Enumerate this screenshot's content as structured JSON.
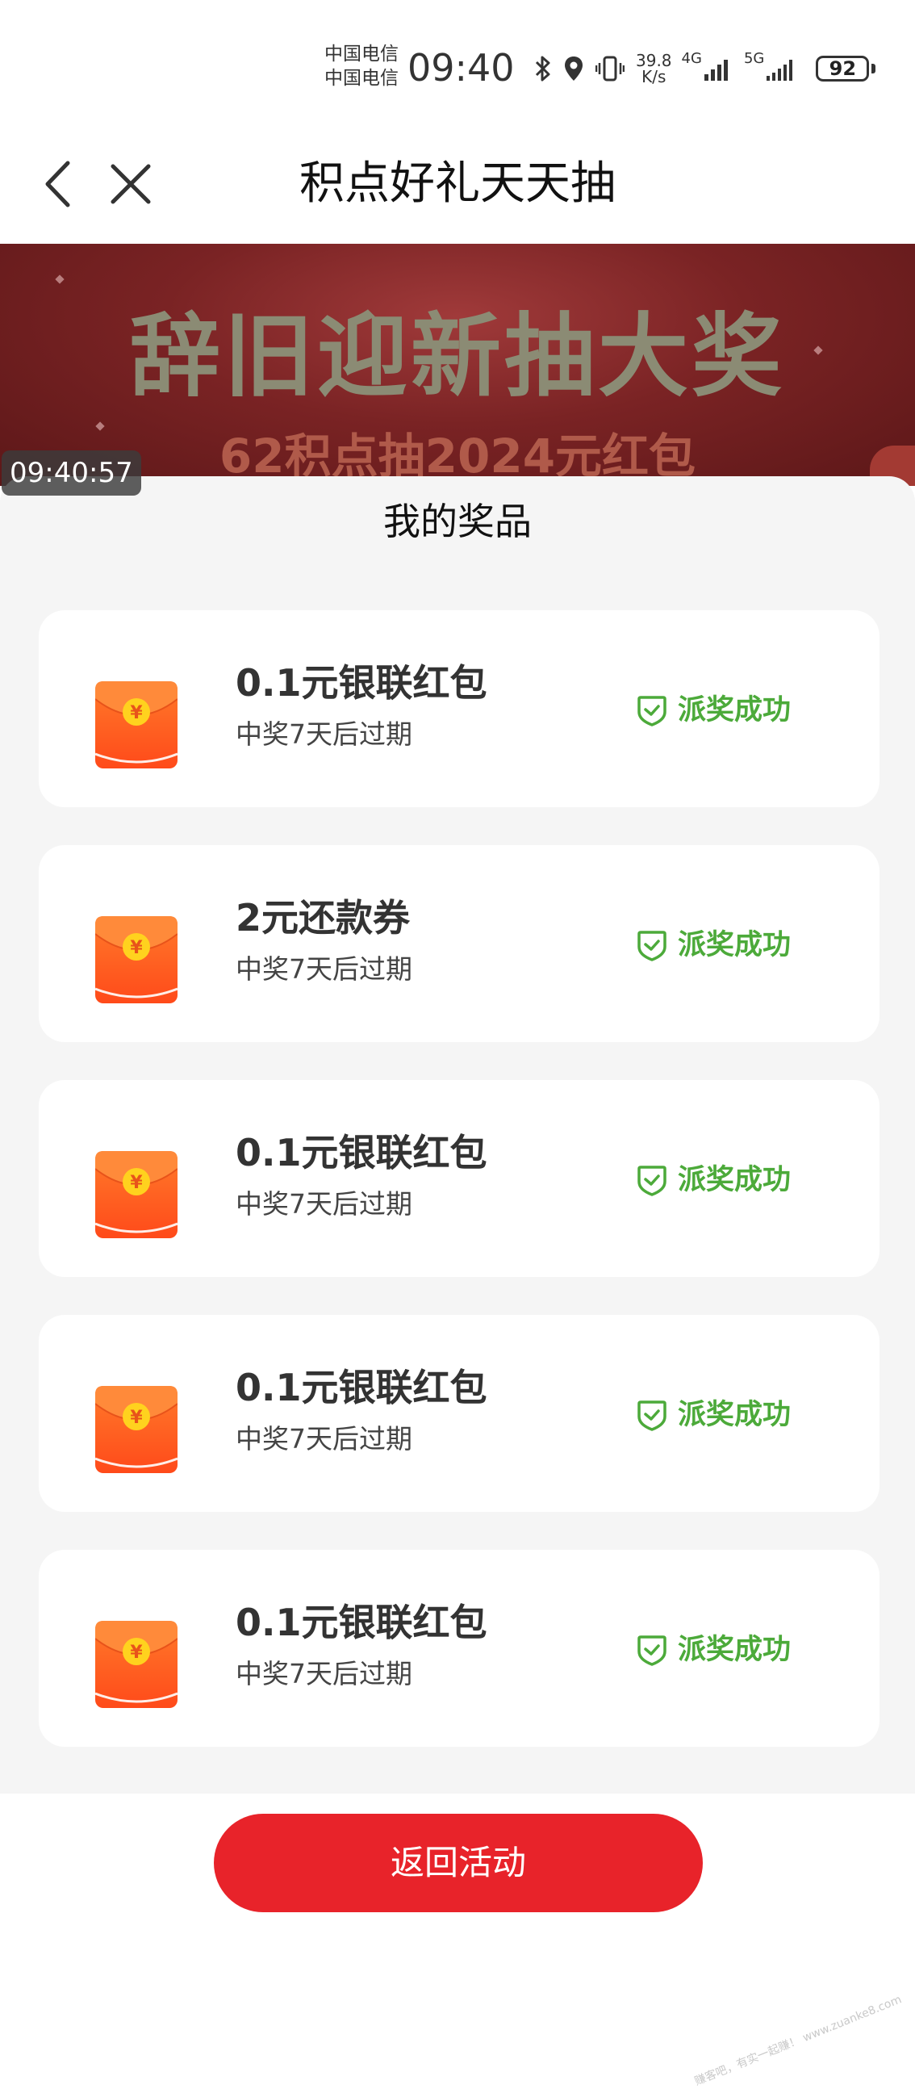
{
  "status_bar": {
    "carrier_1": "中国电信",
    "carrier_2": "中国电信",
    "time": "09:40",
    "net_speed_value": "39.8",
    "net_speed_unit": "K/s",
    "network_1": "4G",
    "network_2": "5G",
    "battery": "92"
  },
  "header": {
    "title": "积点好礼天天抽"
  },
  "banner": {
    "title": "辞旧迎新抽大奖",
    "subtitle": "62积点抽2024元红包"
  },
  "overlay": {
    "timestamp": "09:40:57"
  },
  "sheet": {
    "title": "我的奖品"
  },
  "prizes": [
    {
      "name": "0.1元银联红包",
      "expire": "中奖7天后过期",
      "status": "派奖成功"
    },
    {
      "name": "2元还款券",
      "expire": "中奖7天后过期",
      "status": "派奖成功"
    },
    {
      "name": "0.1元银联红包",
      "expire": "中奖7天后过期",
      "status": "派奖成功"
    },
    {
      "name": "0.1元银联红包",
      "expire": "中奖7天后过期",
      "status": "派奖成功"
    },
    {
      "name": "0.1元银联红包",
      "expire": "中奖7天后过期",
      "status": "派奖成功"
    }
  ],
  "footer": {
    "return_label": "返回活动",
    "watermark": "赚客吧，有实一起赚！ www.zuanke8.com"
  },
  "colors": {
    "primary_red": "#e8232a",
    "success_green": "#4caa3a",
    "envelope_orange": "#ff5a1f",
    "coin_yellow": "#ffd21e"
  }
}
